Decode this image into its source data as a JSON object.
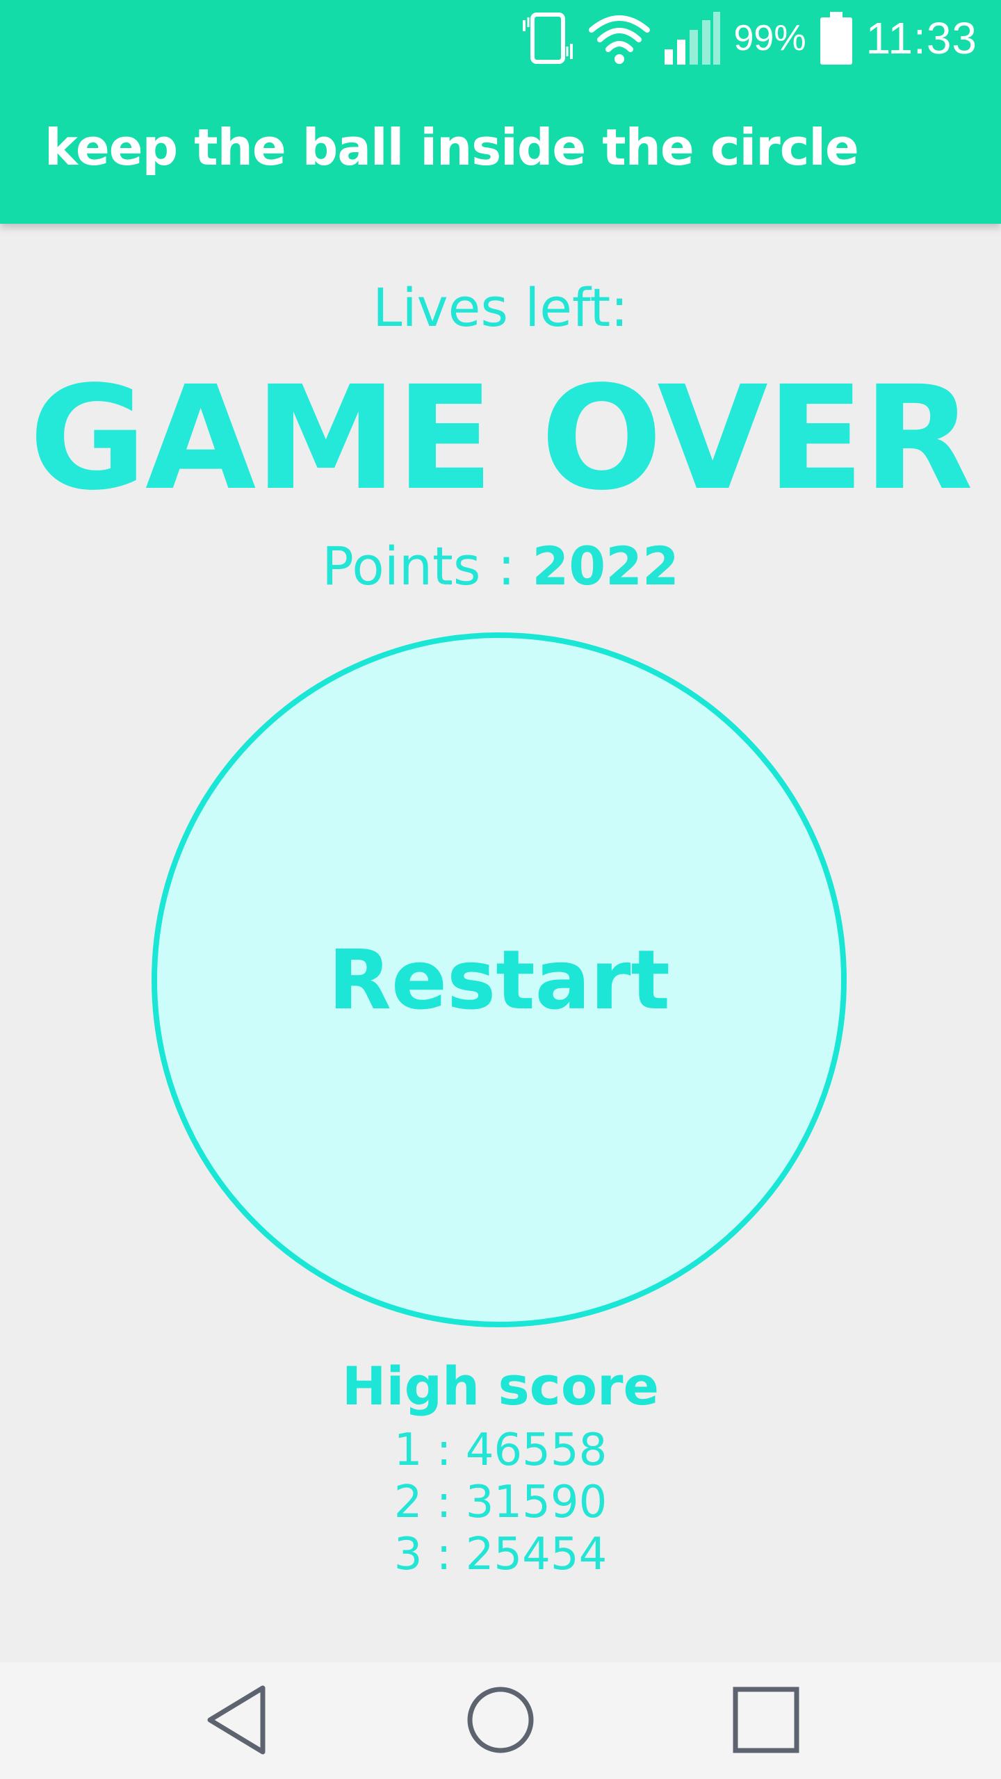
{
  "status_bar": {
    "battery_percent": "99%",
    "time": "11:33",
    "icons": [
      "vibrate-icon",
      "wifi-icon",
      "signal-icon",
      "battery-icon"
    ]
  },
  "app_bar": {
    "title": "keep the ball inside the circle"
  },
  "game": {
    "lives_label": "Lives left:",
    "status": "GAME OVER",
    "points_label": "Points : ",
    "points_value": "2022",
    "restart_label": "Restart"
  },
  "high_score": {
    "title": "High score",
    "entries": [
      {
        "text": "1 : 46558"
      },
      {
        "text": "2 : 31590"
      },
      {
        "text": "3 : 25454"
      }
    ]
  },
  "nav_bar": {
    "icons": [
      "back-icon",
      "home-icon",
      "recent-apps-icon"
    ]
  },
  "colors": {
    "app_bar": "#14dca9",
    "accent": "#25e9d8",
    "circle_fill": "#ccfdfb",
    "background": "#eeeeee"
  }
}
